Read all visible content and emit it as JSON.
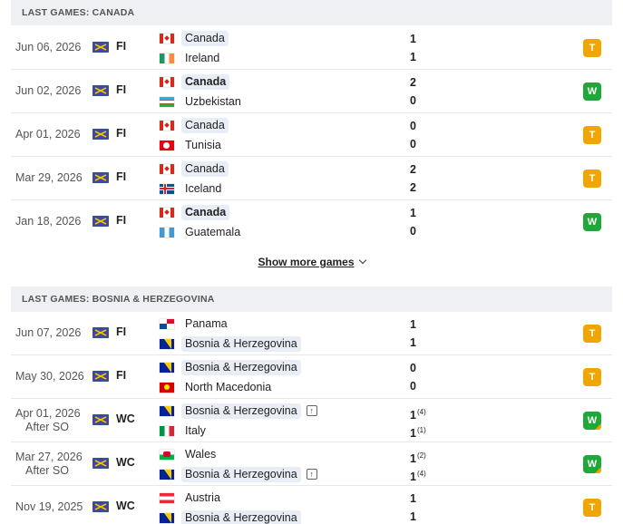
{
  "canada": {
    "header": "LAST GAMES: CANADA",
    "games": [
      {
        "date": "Jun 06, 2026",
        "sub": "",
        "comp": "FI",
        "home": "Canada",
        "home_flag": "ca",
        "away": "Ireland",
        "away_flag": "ie",
        "home_score": "1",
        "away_score": "1",
        "home_pen": "",
        "away_pen": "",
        "result": "T"
      },
      {
        "date": "Jun 02, 2026",
        "sub": "",
        "comp": "FI",
        "home": "Canada",
        "home_flag": "ca",
        "away": "Uzbekistan",
        "away_flag": "uz",
        "home_score": "2",
        "away_score": "0",
        "home_pen": "",
        "away_pen": "",
        "result": "W"
      },
      {
        "date": "Apr 01, 2026",
        "sub": "",
        "comp": "FI",
        "home": "Canada",
        "home_flag": "ca",
        "away": "Tunisia",
        "away_flag": "tn",
        "home_score": "0",
        "away_score": "0",
        "home_pen": "",
        "away_pen": "",
        "result": "T"
      },
      {
        "date": "Mar 29, 2026",
        "sub": "",
        "comp": "FI",
        "home": "Canada",
        "home_flag": "ca",
        "away": "Iceland",
        "away_flag": "is",
        "home_score": "2",
        "away_score": "2",
        "home_pen": "",
        "away_pen": "",
        "result": "T"
      },
      {
        "date": "Jan 18, 2026",
        "sub": "",
        "comp": "FI",
        "home": "Canada",
        "home_flag": "ca",
        "away": "Guatemala",
        "away_flag": "gt",
        "home_score": "1",
        "away_score": "0",
        "home_pen": "",
        "away_pen": "",
        "result": "W"
      }
    ]
  },
  "show_more": "Show more games",
  "bosnia": {
    "header": "LAST GAMES: BOSNIA & HERZEGOVINA",
    "games": [
      {
        "date": "Jun 07, 2026",
        "sub": "",
        "comp": "FI",
        "home": "Panama",
        "home_flag": "pa",
        "away": "Bosnia & Herzegovina",
        "away_flag": "ba",
        "home_score": "1",
        "away_score": "1",
        "home_pen": "",
        "away_pen": "",
        "result": "T"
      },
      {
        "date": "May 30, 2026",
        "sub": "",
        "comp": "FI",
        "home": "Bosnia & Herzegovina",
        "home_flag": "ba",
        "away": "North Macedonia",
        "away_flag": "mk",
        "home_score": "0",
        "away_score": "0",
        "home_pen": "",
        "away_pen": "",
        "result": "T"
      },
      {
        "date": "Apr 01, 2026",
        "sub": "After SO",
        "comp": "WC",
        "home": "Bosnia & Herzegovina",
        "home_flag": "ba",
        "away": "Italy",
        "away_flag": "it",
        "home_score": "1",
        "away_score": "1",
        "home_pen": "(4)",
        "away_pen": "(1)",
        "result": "W"
      },
      {
        "date": "Mar 27, 2026",
        "sub": "After SO",
        "comp": "WC",
        "home": "Wales",
        "home_flag": "wls",
        "away": "Bosnia & Herzegovina",
        "away_flag": "ba",
        "home_score": "1",
        "away_score": "1",
        "home_pen": "(2)",
        "away_pen": "(4)",
        "result": "W"
      },
      {
        "date": "Nov 19, 2025",
        "sub": "",
        "comp": "WC",
        "home": "Austria",
        "home_flag": "at",
        "away": "Bosnia & Herzegovina",
        "away_flag": "ba",
        "home_score": "1",
        "away_score": "1",
        "home_pen": "",
        "away_pen": "",
        "result": "T"
      }
    ]
  }
}
